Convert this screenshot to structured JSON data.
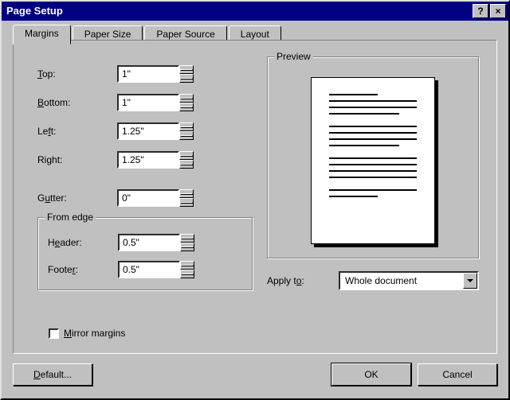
{
  "title": "Page Setup",
  "tabs": {
    "margins": "Margins",
    "paper_size": "Paper Size",
    "paper_source": "Paper Source",
    "layout": "Layout"
  },
  "labels": {
    "top": "Top:",
    "bottom": "Bottom:",
    "left": "Left:",
    "right": "Right:",
    "gutter": "Gutter:",
    "from_edge": "From edge",
    "header": "Header:",
    "footer": "Footer:",
    "mirror": "Mirror margins",
    "preview": "Preview",
    "apply_to": "Apply to:"
  },
  "values": {
    "top": "1\"",
    "bottom": "1\"",
    "left": "1.25\"",
    "right": "1.25\"",
    "gutter": "0\"",
    "header": "0.5\"",
    "footer": "0.5\"",
    "apply_to": "Whole document"
  },
  "buttons": {
    "default": "Default...",
    "ok": "OK",
    "cancel": "Cancel",
    "help": "?",
    "close": "×"
  }
}
